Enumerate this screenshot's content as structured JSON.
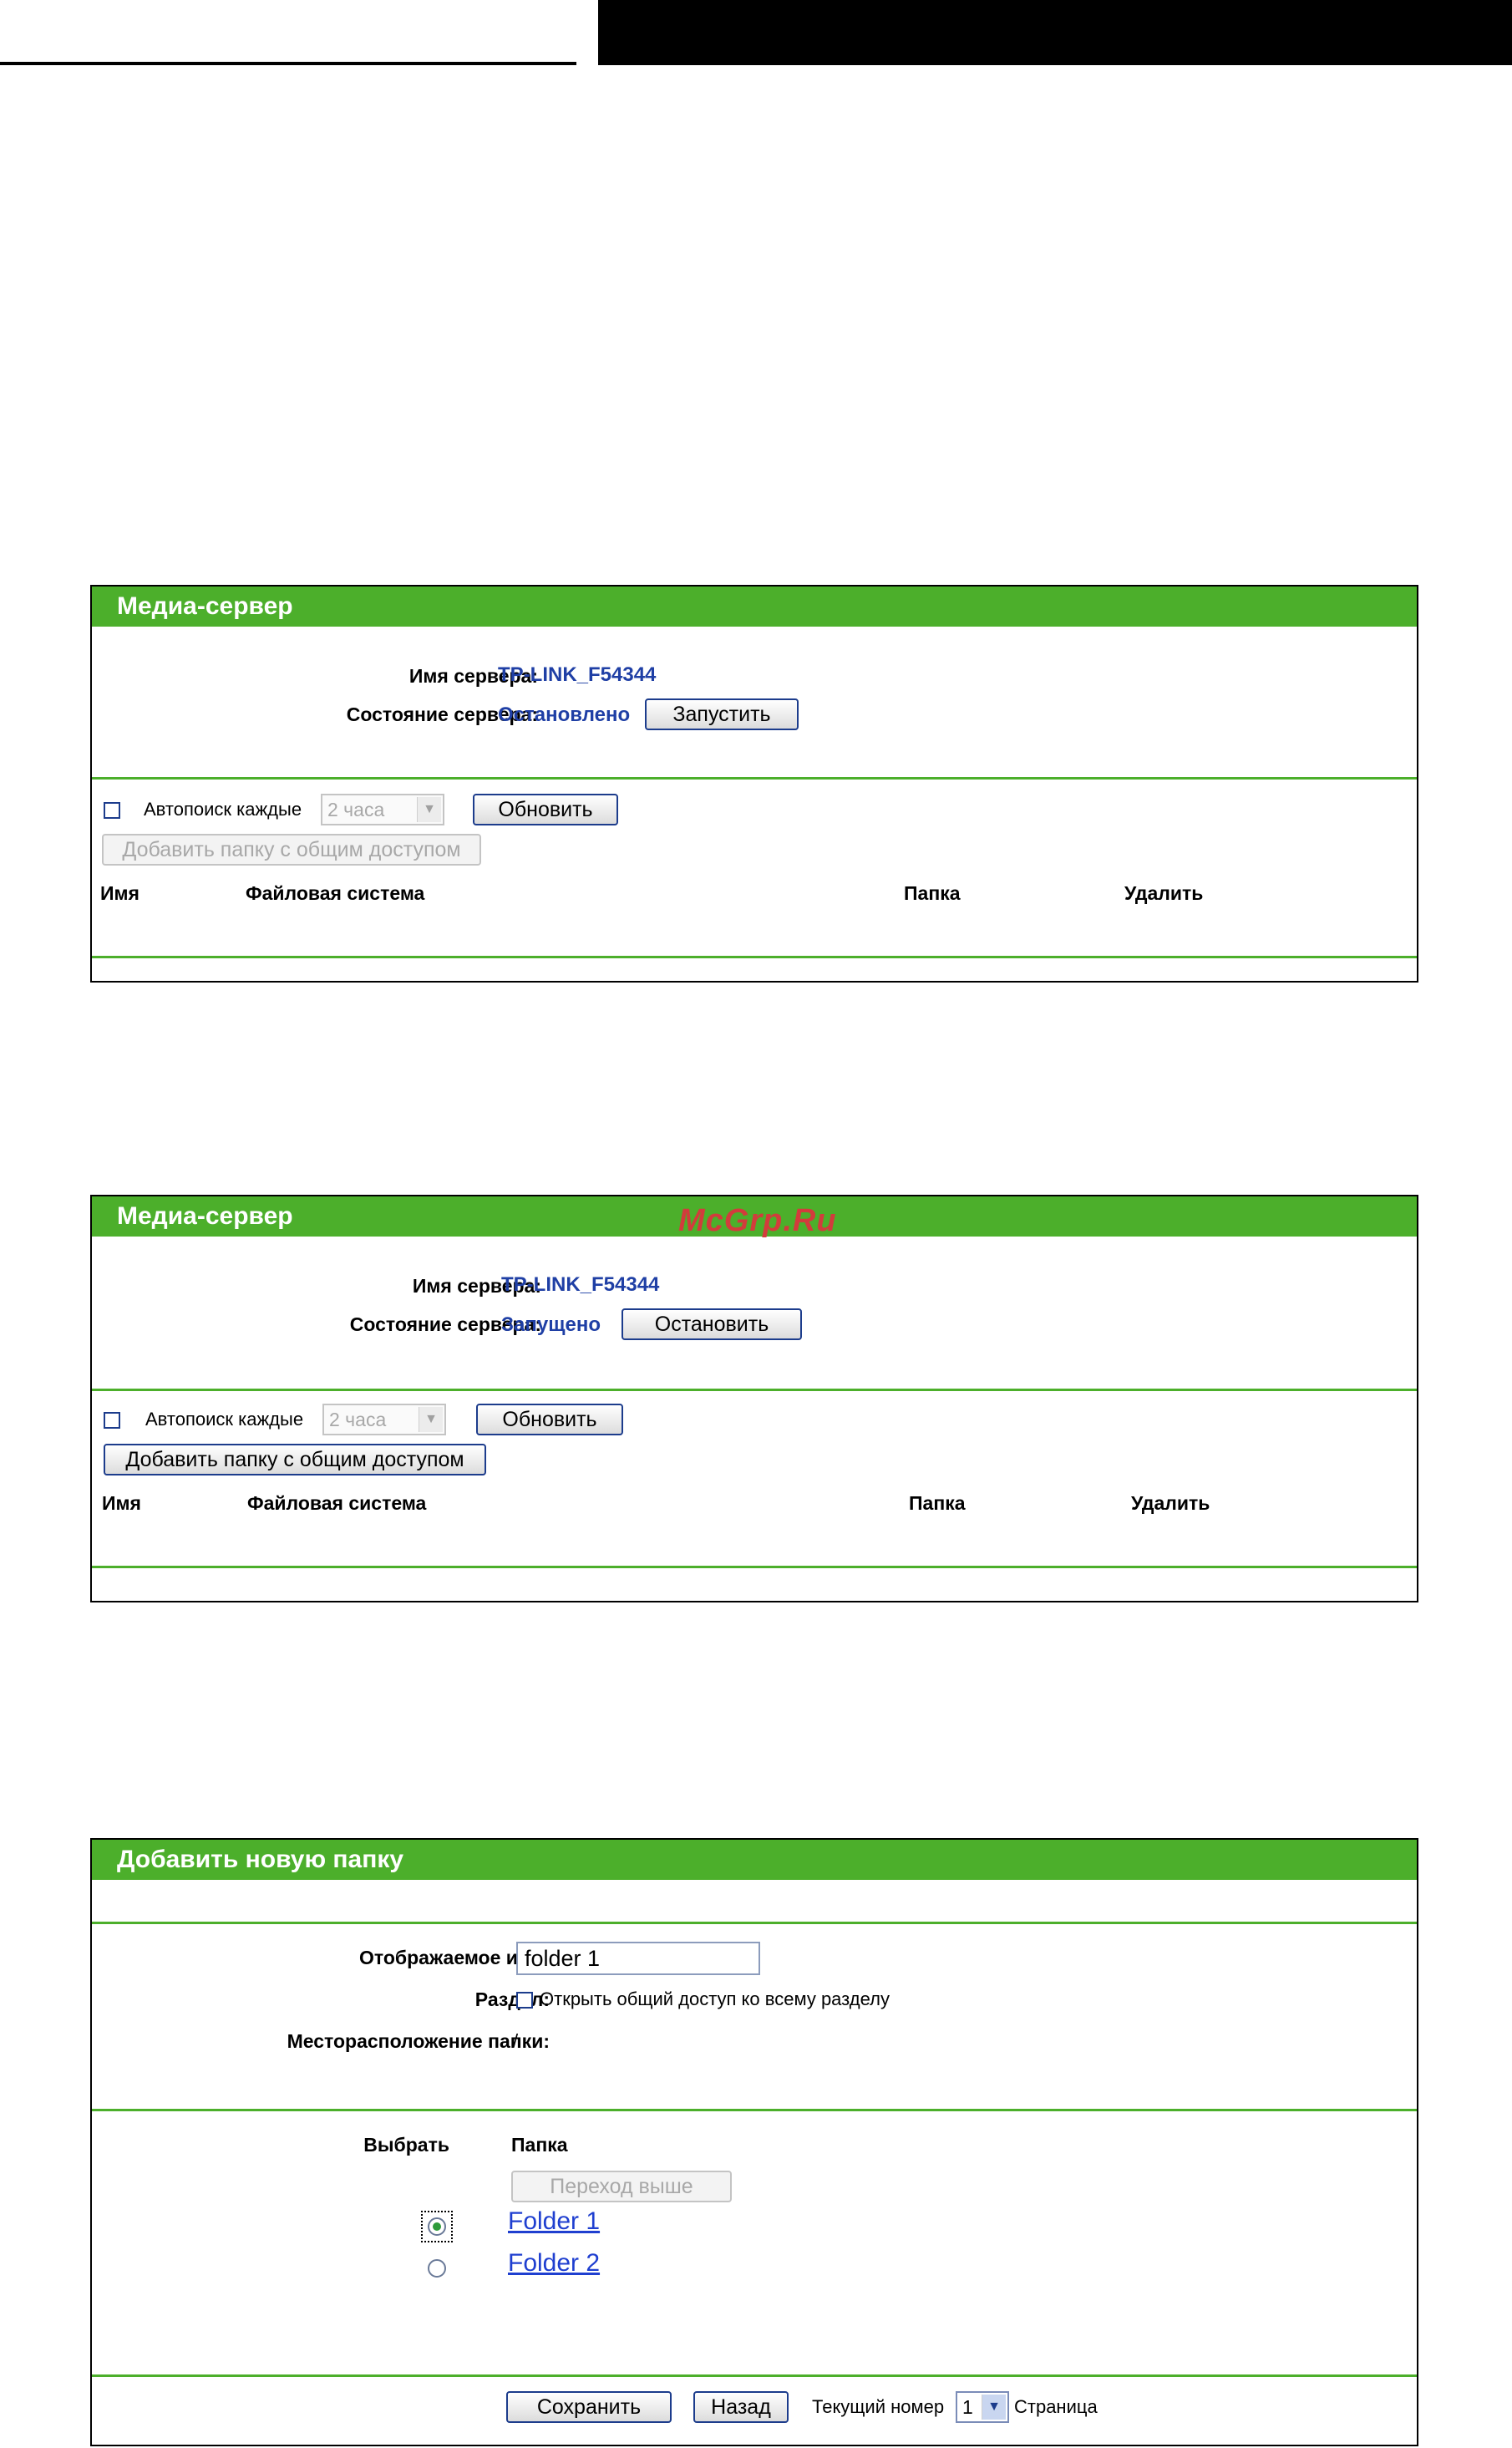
{
  "watermark": "McGrp.Ru",
  "panel1": {
    "title": "Медиа-сервер",
    "server_name_label": "Имя сервера:",
    "server_name": "TP-LINK_F54344",
    "server_state_label": "Состояние сервера:",
    "server_state": "Остановлено",
    "action_button": "Запустить",
    "auto_scan_label": "Автопоиск каждые",
    "auto_scan_value": "2 часа",
    "refresh_button": "Обновить",
    "add_share_button": "Добавить папку с общим доступом",
    "columns": [
      "Имя",
      "Файловая система",
      "Папка",
      "Удалить"
    ]
  },
  "panel2": {
    "title": "Медиа-сервер",
    "server_name_label": "Имя сервера:",
    "server_name": "TP-LINK_F54344",
    "server_state_label": "Состояние сервера:",
    "server_state": "Запущено",
    "action_button": "Остановить",
    "auto_scan_label": "Автопоиск каждые",
    "auto_scan_value": "2 часа",
    "refresh_button": "Обновить",
    "add_share_button": "Добавить папку с общим доступом",
    "columns": [
      "Имя",
      "Файловая система",
      "Папка",
      "Удалить"
    ]
  },
  "panel3": {
    "title": "Добавить новую папку",
    "display_name_label": "Отображаемое имя:",
    "display_name_value": "folder 1",
    "partition_label": "Раздел:",
    "share_partition_label": "Открыть общий доступ ко всему разделу",
    "folder_location_label": "Месторасположение папки:",
    "folder_location_value": "/",
    "select_header": "Выбрать",
    "folder_header": "Папка",
    "up_button": "Переход выше",
    "folders": [
      "Folder 1",
      "Folder 2"
    ],
    "save_button": "Сохранить",
    "back_button": "Назад",
    "current_number_label": "Текущий номер",
    "page_select_value": "1",
    "page_label": "Страница"
  }
}
